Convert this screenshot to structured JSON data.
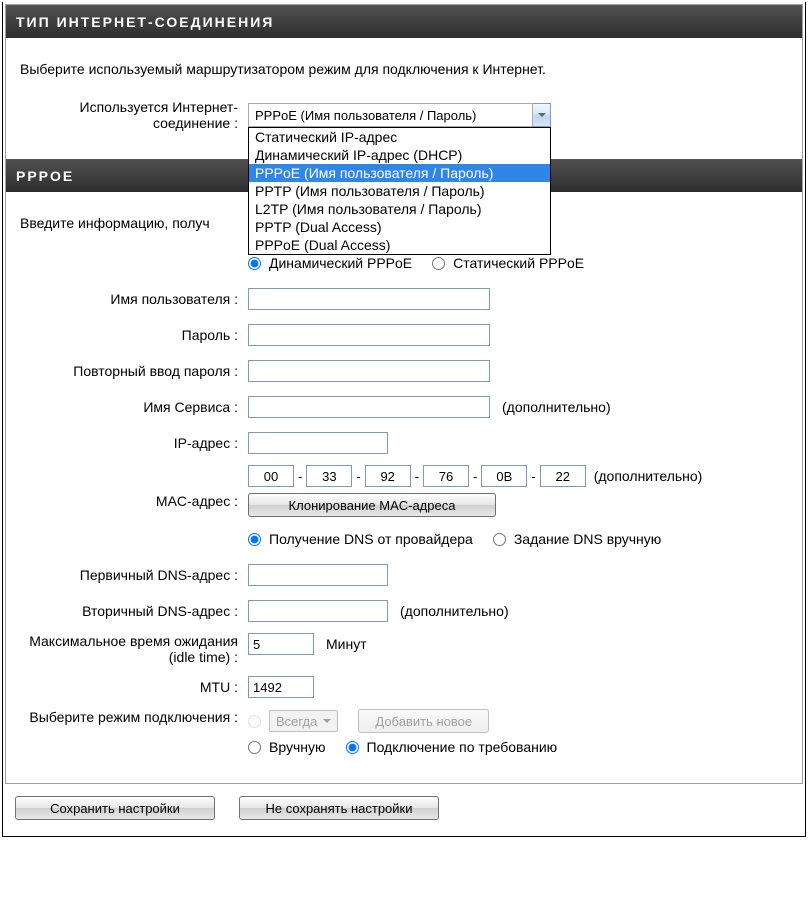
{
  "sections": {
    "conn_type_title": "ТИП ИНТЕРНЕТ-СОЕДИНЕНИЯ",
    "conn_type_intro": "Выберите используемый маршрутизатором режим для подключения к Интернет.",
    "conn_used_label": "Используется Интернет-соединение :",
    "pppoe_title": "PPPOE",
    "pppoe_intro": "Введите информацию, получ"
  },
  "dropdown": {
    "selected": "PPPoE (Имя пользователя / Пароль)",
    "options": [
      "Статический IP-адрес",
      "Динамический IP-адрес (DHCP)",
      "PPPoE (Имя пользователя / Пароль)",
      "PPTP (Имя пользователя / Пароль)",
      "L2TP (Имя пользователя / Пароль)",
      "PPTP (Dual Access)",
      "PPPoE (Dual Access)"
    ],
    "selected_index": 2
  },
  "pppoe_mode": {
    "dynamic": "Динамический PPPoE",
    "static": "Статический PPPoE"
  },
  "labels": {
    "username": "Имя пользователя :",
    "password": "Пароль :",
    "password2": "Повторный ввод пароля :",
    "service": "Имя Сервиса :",
    "ip": "IP-адрес :",
    "mac": "MAC-адрес :",
    "dns1": "Первичный DNS-адрес :",
    "dns2": "Вторичный DNS-адрес :",
    "idle": "Максимальное время ожидания (idle time) :",
    "mtu": "MTU :",
    "connmode": "Выберите режим подключения :",
    "optional": "(дополнительно)",
    "minutes": "Минут",
    "clone_mac": "Клонирование MAC-адреса",
    "dns_provider": "Получение DNS от провайдера",
    "dns_manual": "Задание DNS вручную",
    "always": "Всегда",
    "add_new": "Добавить новое",
    "manual": "Вручную",
    "on_demand": "Подключение по требованию"
  },
  "values": {
    "username": "",
    "password": "",
    "password2": "",
    "service": "",
    "ip": "",
    "mac": [
      "00",
      "33",
      "92",
      "76",
      "0B",
      "22"
    ],
    "dns1": "",
    "dns2": "",
    "idle": "5",
    "mtu": "1492"
  },
  "buttons": {
    "save": "Сохранить настройки",
    "dontsave": "Не сохранять настройки"
  }
}
